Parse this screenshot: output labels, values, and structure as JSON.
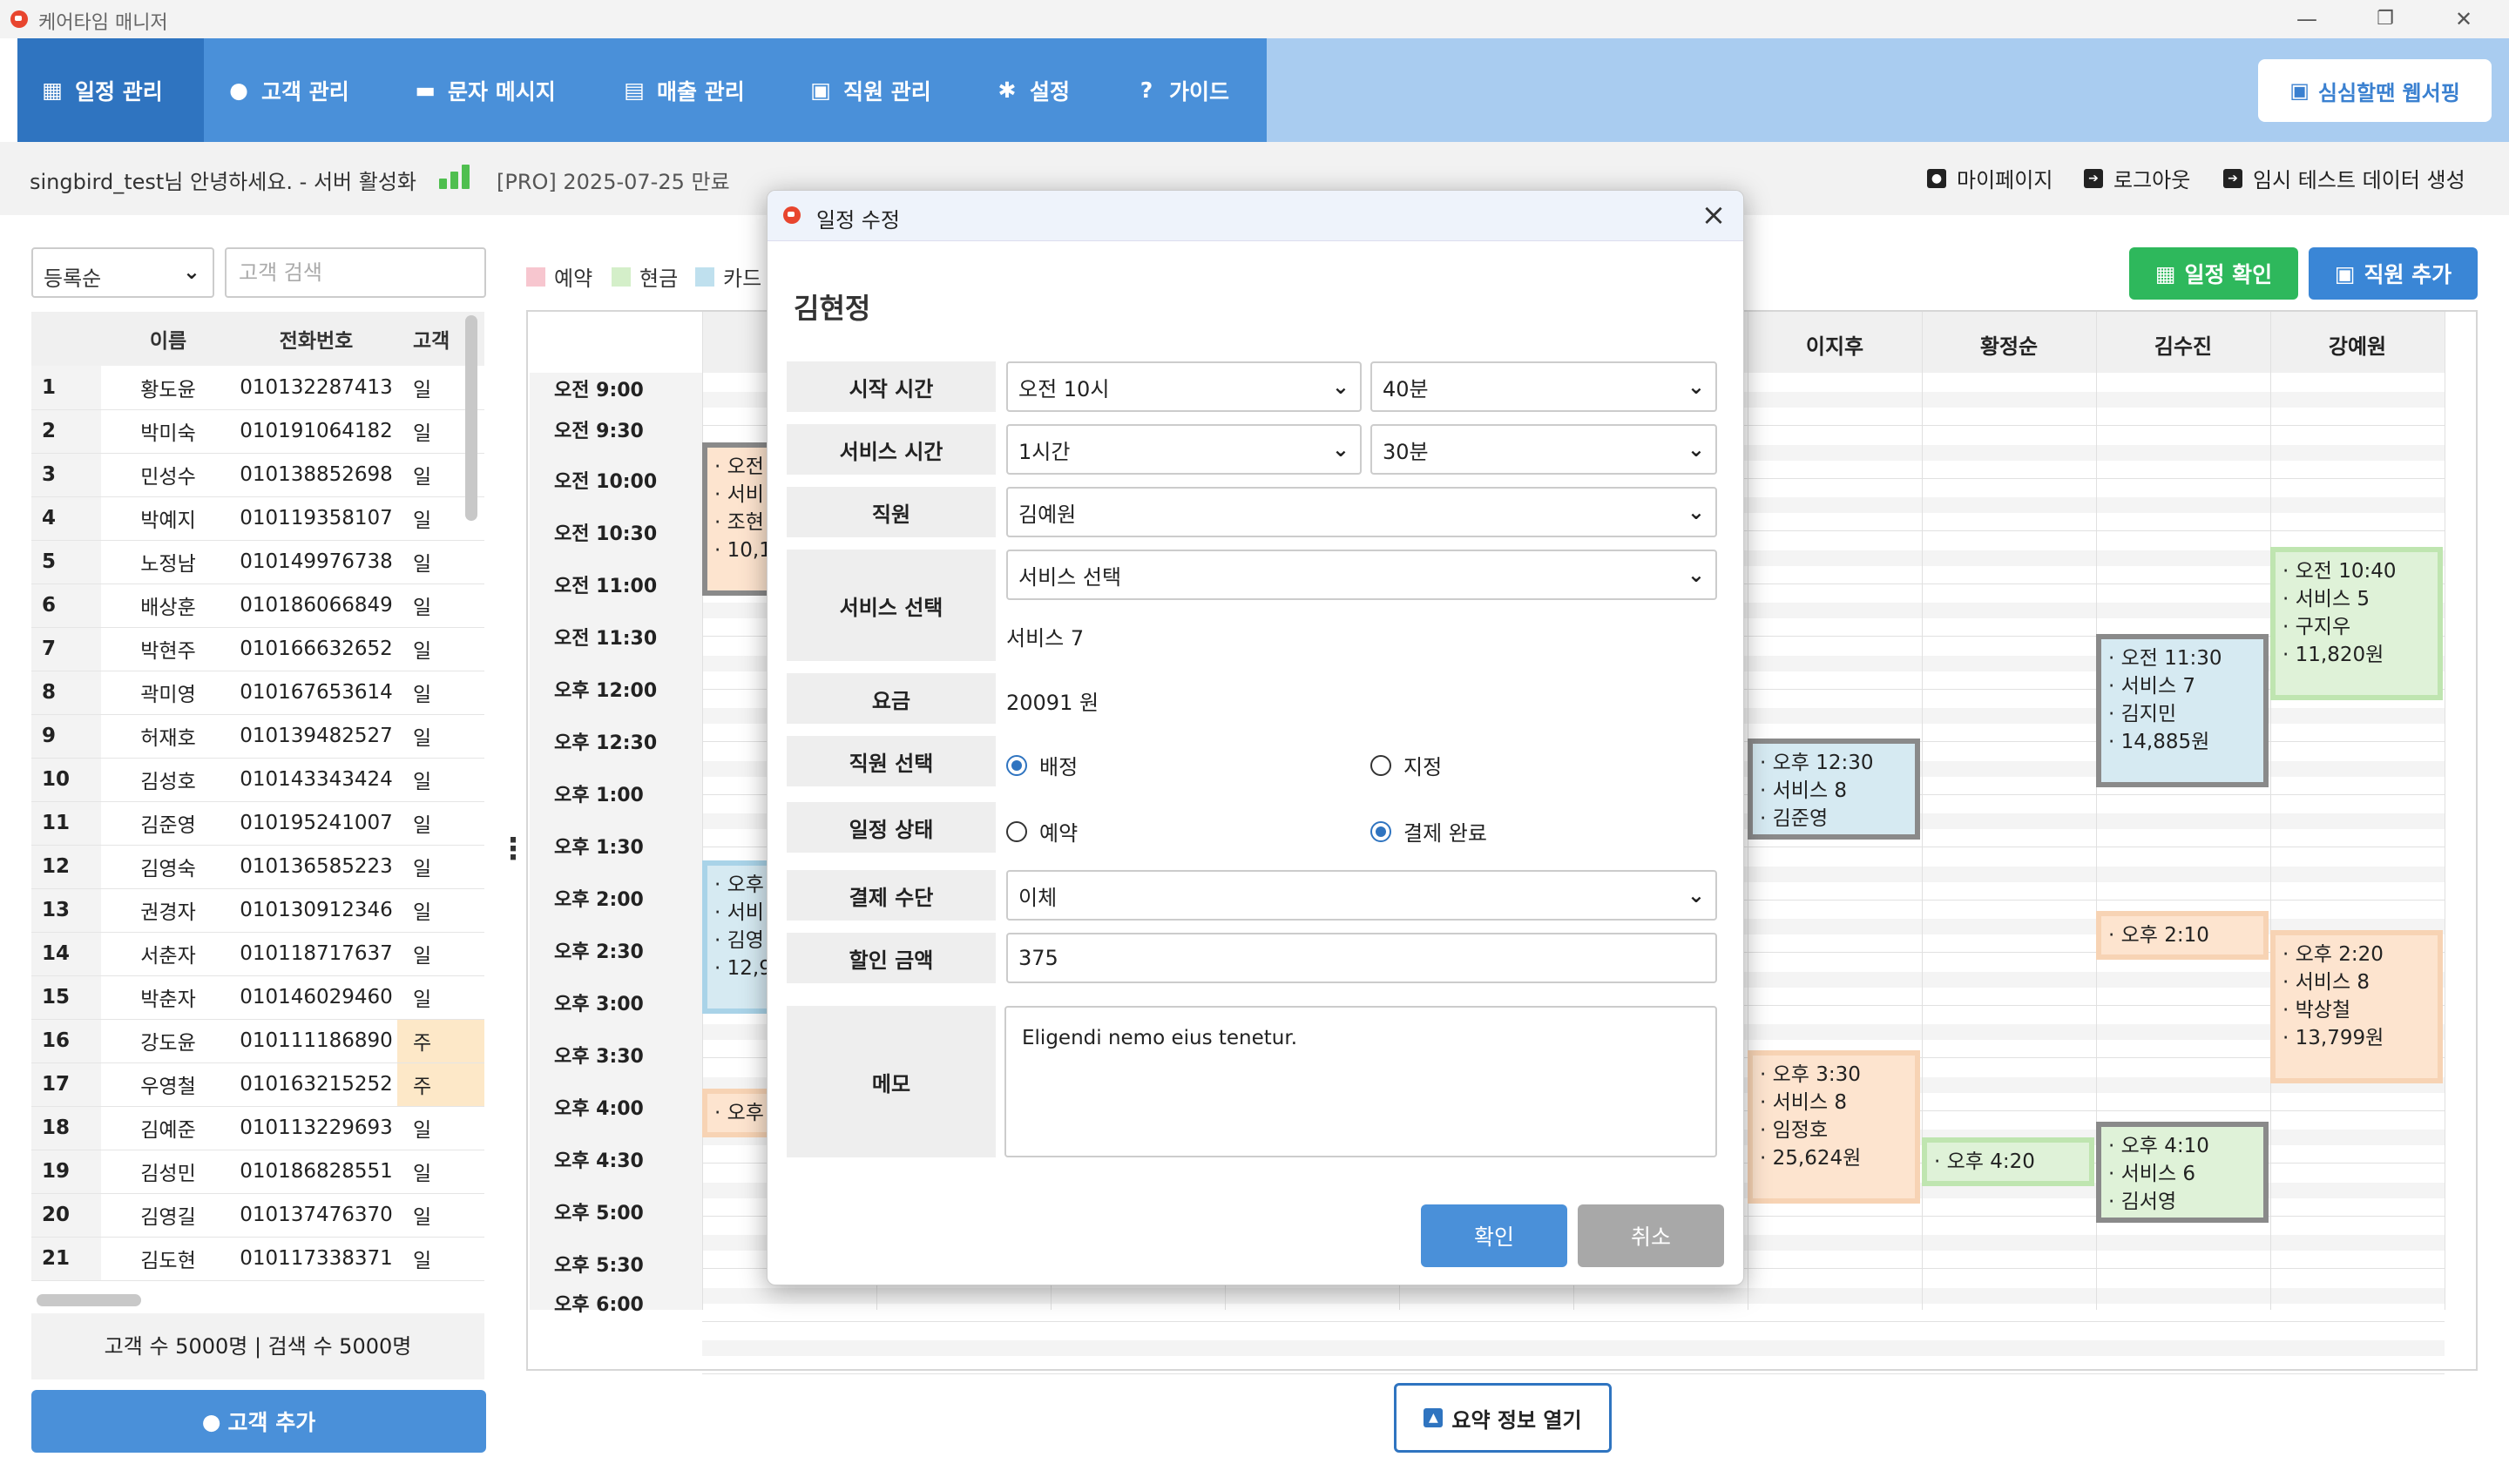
{
  "window": {
    "title": "케어타임 매니저",
    "controls": [
      "minimize-icon",
      "restore-icon",
      "close-icon"
    ]
  },
  "nav": {
    "items": [
      {
        "label": "일정 관리",
        "icon": "calendar-icon",
        "active": true
      },
      {
        "label": "고객 관리",
        "icon": "person-icon"
      },
      {
        "label": "문자 메시지",
        "icon": "chat-icon"
      },
      {
        "label": "매출 관리",
        "icon": "chart-icon"
      },
      {
        "label": "직원 관리",
        "icon": "badge-icon"
      },
      {
        "label": "설정",
        "icon": "gear-icon"
      },
      {
        "label": "가이드",
        "icon": "help-icon"
      }
    ],
    "web_button": "심심할땐 웹서핑"
  },
  "infobar": {
    "greeting": "singbird_test님 안녕하세요. - 서버 활성화",
    "plan": "[PRO] 2025-07-25 만료",
    "actions": [
      "마이페이지",
      "로그아웃",
      "임시 테스트 데이터 생성"
    ]
  },
  "left": {
    "sort_value": "등록순",
    "search_placeholder": "고객 검색",
    "columns": [
      "",
      "이름",
      "전화번호",
      "고객"
    ],
    "rows": [
      [
        "1",
        "황도윤",
        "010132287413",
        "일"
      ],
      [
        "2",
        "박미숙",
        "010191064182",
        "일"
      ],
      [
        "3",
        "민성수",
        "010138852698",
        "일"
      ],
      [
        "4",
        "박예지",
        "010119358107",
        "일"
      ],
      [
        "5",
        "노정남",
        "010149976738",
        "일"
      ],
      [
        "6",
        "배상훈",
        "010186066849",
        "일"
      ],
      [
        "7",
        "박현주",
        "010166632652",
        "일"
      ],
      [
        "8",
        "곽미영",
        "010167653614",
        "일"
      ],
      [
        "9",
        "허재호",
        "010139482527",
        "일"
      ],
      [
        "10",
        "김성호",
        "010143343424",
        "일"
      ],
      [
        "11",
        "김준영",
        "010195241007",
        "일"
      ],
      [
        "12",
        "김영숙",
        "010136585223",
        "일"
      ],
      [
        "13",
        "권경자",
        "010130912346",
        "일"
      ],
      [
        "14",
        "서춘자",
        "010118717637",
        "일"
      ],
      [
        "15",
        "박춘자",
        "010146029460",
        "일"
      ],
      [
        "16",
        "강도윤",
        "010111186890",
        "주"
      ],
      [
        "17",
        "우영철",
        "010163215252",
        "주"
      ],
      [
        "18",
        "김예준",
        "010113229693",
        "일"
      ],
      [
        "19",
        "김성민",
        "010186828551",
        "일"
      ],
      [
        "20",
        "김영길",
        "010137476370",
        "일"
      ],
      [
        "21",
        "김도현",
        "010117338371",
        "일"
      ]
    ],
    "count_text": "고객 수 5000명 | 검색 수 5000명",
    "add_button": "고객 추가"
  },
  "legend": [
    {
      "label": "예약",
      "color": "#f7c6cf"
    },
    {
      "label": "현금",
      "color": "#d4efc9"
    },
    {
      "label": "카드",
      "color": "#bfe0ee"
    }
  ],
  "schedule": {
    "times": [
      "오전 9:00",
      "오전 9:30",
      "오전 10:00",
      "오전 10:30",
      "오전 11:00",
      "오전 11:30",
      "오후 12:00",
      "오후 12:30",
      "오후 1:00",
      "오후 1:30",
      "오후 2:00",
      "오후 2:30",
      "오후 3:00",
      "오후 3:30",
      "오후 4:00",
      "오후 4:30",
      "오후 5:00",
      "오후 5:30",
      "오후 6:00"
    ],
    "staff": [
      "이지후",
      "황정순",
      "김수진",
      "강예원"
    ],
    "events": [
      {
        "lines": [
          "· 오전",
          "· 서비",
          "· 조현",
          "· 10,1"
        ],
        "style": "orgray"
      },
      {
        "lines": [
          "· 오후",
          "· 서비",
          "· 김영",
          "· 12,9"
        ],
        "style": "bluelight"
      },
      {
        "lines": [
          "· 오후"
        ],
        "style": "orange"
      },
      {
        "lines": [
          "· 오후 12:30",
          "· 서비스 8",
          "· 김준영"
        ],
        "style": "blue"
      },
      {
        "lines": [
          "· 오후 3:30",
          "· 서비스 8",
          "· 임정호",
          "· 25,624원"
        ],
        "style": "orange"
      },
      {
        "lines": [
          "· 오후 4:20"
        ],
        "style": "green"
      },
      {
        "lines": [
          "· 오전 11:30",
          "· 서비스 7",
          "· 김지민",
          "· 14,885원"
        ],
        "style": "blue"
      },
      {
        "lines": [
          "· 오후 2:10"
        ],
        "style": "orange"
      },
      {
        "lines": [
          "· 오후 4:10",
          "· 서비스 6",
          "· 김서영"
        ],
        "style": "greengray"
      },
      {
        "lines": [
          "· 오전 10:40",
          "· 서비스 5",
          "· 구지우",
          "· 11,820원"
        ],
        "style": "green"
      },
      {
        "lines": [
          "· 오후 2:20",
          "· 서비스 8",
          "· 박상철",
          "· 13,799원"
        ],
        "style": "orange"
      }
    ],
    "confirm_button": "일정 확인",
    "add_staff_button": "직원 추가",
    "summary_button": "요약 정보 열기"
  },
  "modal": {
    "title": "일정 수정",
    "customer": "김현정",
    "labels": {
      "start": "시작 시간",
      "duration": "서비스 시간",
      "staff": "직원",
      "service": "서비스 선택",
      "fee": "요금",
      "staff_select": "직원 선택",
      "status": "일정 상태",
      "payment": "결제 수단",
      "discount": "할인 금액",
      "memo": "메모"
    },
    "start_hour": "오전 10시",
    "start_min": "40분",
    "dur_hour": "1시간",
    "dur_min": "30분",
    "staff_value": "김예원",
    "service_value": "서비스 선택",
    "service_selected": "서비스 7",
    "fee_value": "20091 원",
    "staff_mode": {
      "options": [
        "배정",
        "지정"
      ],
      "selected": "배정"
    },
    "status": {
      "options": [
        "예약",
        "결제 완료"
      ],
      "selected": "결제 완료"
    },
    "payment_value": "이체",
    "discount_value": "375",
    "memo_value": "Eligendi nemo eius tenetur.",
    "ok": "확인",
    "cancel": "취소"
  }
}
